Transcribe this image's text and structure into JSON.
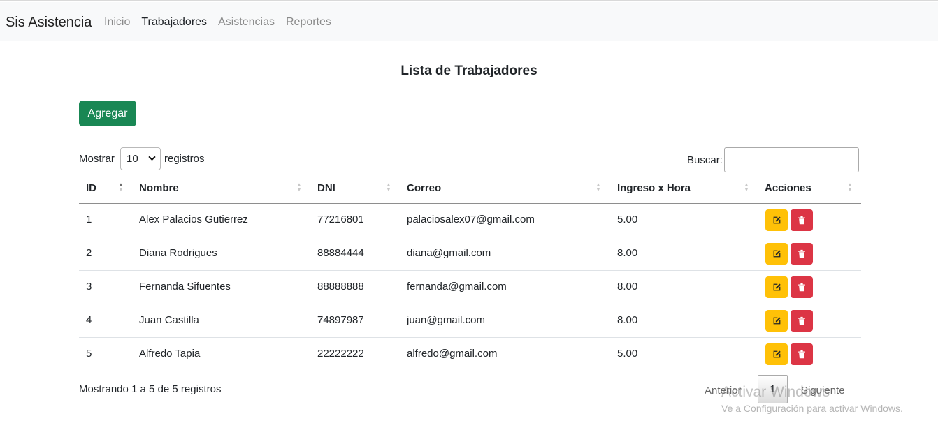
{
  "navbar": {
    "brand": "Sis Asistencia",
    "links": [
      {
        "label": "Inicio",
        "active": false
      },
      {
        "label": "Trabajadores",
        "active": true
      },
      {
        "label": "Asistencias",
        "active": false
      },
      {
        "label": "Reportes",
        "active": false
      }
    ]
  },
  "page": {
    "title": "Lista de Trabajadores",
    "add_button": "Agregar"
  },
  "table_controls": {
    "show_label": "Mostrar",
    "page_size": "10",
    "show_suffix": "registros",
    "search_label": "Buscar:",
    "search_value": ""
  },
  "table": {
    "columns": [
      "ID",
      "Nombre",
      "DNI",
      "Correo",
      "Ingreso x Hora",
      "Acciones"
    ],
    "rows": [
      [
        "1",
        "Alex Palacios Gutierrez",
        "77216801",
        "palaciosalex07@gmail.com",
        "5.00"
      ],
      [
        "2",
        "Diana Rodrigues",
        "88884444",
        "diana@gmail.com",
        "8.00"
      ],
      [
        "3",
        "Fernanda Sifuentes",
        "88888888",
        "fernanda@gmail.com",
        "8.00"
      ],
      [
        "4",
        "Juan Castilla",
        "74897987",
        "juan@gmail.com",
        "8.00"
      ],
      [
        "5",
        "Alfredo Tapia",
        "22222222",
        "alfredo@gmail.com",
        "5.00"
      ]
    ]
  },
  "footer": {
    "info": "Mostrando 1 a 5 de 5 registros",
    "prev": "Anterior",
    "page": "1",
    "next": "Siguiente"
  },
  "watermark": {
    "line1": "Activar Windows",
    "line2": "Ve a Configuración para activar Windows."
  },
  "colors": {
    "add": "#198754",
    "edit": "#ffc107",
    "delete": "#dc3545"
  }
}
